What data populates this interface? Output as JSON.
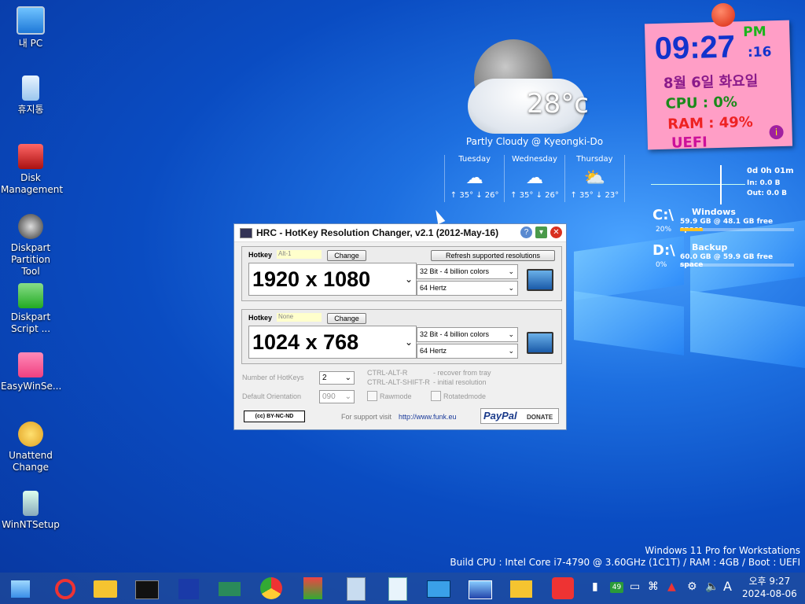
{
  "desktop_icons": [
    {
      "label": "내 PC",
      "icon": "pc-icon"
    },
    {
      "label": "휴지통",
      "icon": "recycle-bin-icon"
    },
    {
      "label": "Disk Management",
      "icon": "disk-management-icon"
    },
    {
      "label": "Diskpart Partition Tool",
      "icon": "hard-disk-icon"
    },
    {
      "label": "Diskpart Script ...",
      "icon": "diskpart-script-icon"
    },
    {
      "label": "EasyWinSe...",
      "icon": "easywinsetup-icon"
    },
    {
      "label": "Unattend Change",
      "icon": "unattend-icon"
    },
    {
      "label": "WinNTSetup",
      "icon": "winntsetup-icon"
    }
  ],
  "weather": {
    "temp": "28°c",
    "desc": "Partly Cloudy @ Kyeongki-Do",
    "days": [
      {
        "name": "Tuesday",
        "range": "↑ 35° ↓ 26°"
      },
      {
        "name": "Wednesday",
        "range": "↑ 35° ↓ 26°"
      },
      {
        "name": "Thursday",
        "range": "↑ 35° ↓ 23°"
      }
    ]
  },
  "clock": {
    "time": "09:27",
    "ampm": "PM",
    "seconds": ":16",
    "date": "8월 6일 화요일",
    "cpu": "CPU :  0%",
    "ram": "RAM :  49%",
    "boot": "UEFI"
  },
  "network": {
    "uptime": "0d 0h 01m",
    "in": "In: 0.0 B",
    "out": "Out: 0.0 B"
  },
  "drives": [
    {
      "letter": "C:\\",
      "name": "Windows",
      "pct": "20%",
      "info": "59.9 GB @   48.1 GB free space",
      "fill": 0.2
    },
    {
      "letter": "D:\\",
      "name": "Backup",
      "pct": "0%",
      "info": "60.0 GB @   59.9 GB free space",
      "fill": 0.0
    }
  ],
  "hrc": {
    "title": "HRC - HotKey Resolution Changer, v2.1 (2012-May-16)",
    "hotkey_label": "Hotkey",
    "change_label": "Change",
    "refresh_label": "Refresh supported resolutions",
    "profiles": [
      {
        "hotkey": "Alt-1",
        "resolution": "1920 x 1080",
        "color": "32 Bit - 4 billion colors",
        "freq": "64 Hertz"
      },
      {
        "hotkey": "None",
        "resolution": "1024 x 768",
        "color": "32 Bit - 4 billion colors",
        "freq": "64 Hertz"
      }
    ],
    "num_hotkeys_label": "Number of HotKeys",
    "num_hotkeys": "2",
    "orientation_label": "Default Orientation",
    "orientation": "090",
    "shortcut1": "CTRL-ALT-R",
    "shortcut1_desc": "- recover from tray",
    "shortcut2": "CTRL-ALT-SHIFT-R",
    "shortcut2_desc": "- initial resolution",
    "rawmode": "Rawmode",
    "rotatedmode": "Rotatedmode",
    "license": "BY-NC-ND",
    "support_text": "For support visit",
    "support_link": "http://www.funk.eu",
    "paypal": "PayPal",
    "donate": "DONATE"
  },
  "build": {
    "line1": "Windows 11 Pro for Workstations",
    "line2": "Build CPU : Intel Core i7-4790 @ 3.60GHz (1C1T) / RAM : 4GB / Boot : UEFI"
  },
  "taskbar": {
    "badge": "49",
    "ime": "A",
    "time": "오후 9:27",
    "date": "2024-08-06"
  }
}
